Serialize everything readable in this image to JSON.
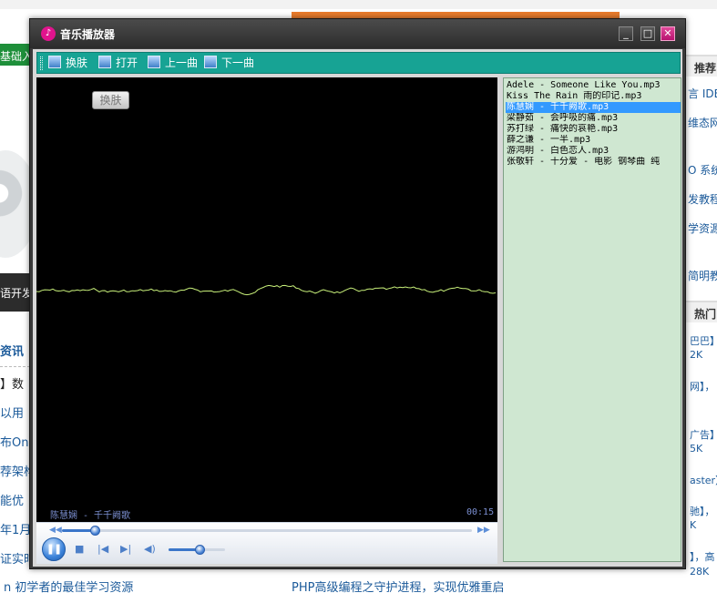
{
  "background_page": {
    "left_tab": "基础入",
    "left_banner": "语开发",
    "left_heading": "资讯",
    "left_items": [
      "】数",
      "以用",
      "布On",
      "荐架构",
      "能优",
      "年1月",
      "证实时"
    ],
    "bottom_left_link": "n 初学者的最佳学习资源",
    "bottom_mid_link": "PHP高级编程之守护进程，实现优雅重启",
    "right_heads": [
      "推荐",
      "热门"
    ],
    "right_links": [
      "言 IDE",
      "维态网",
      "O 系统",
      "发教程",
      "学资源",
      "简明教"
    ],
    "right_small": [
      "巴巴】",
      "2K",
      "网】，",
      "广告】",
      "5K",
      "aster】",
      "驰】，",
      "K",
      "】，高",
      "28K"
    ]
  },
  "window": {
    "title": "音乐播放器",
    "app_icon": "music-note-icon",
    "minimize_glyph": "_",
    "maximize_glyph": "□",
    "close_glyph": "✕"
  },
  "toolbar": {
    "items": [
      {
        "label": "换肤",
        "icon": "image-icon"
      },
      {
        "label": "打开",
        "icon": "image-icon"
      },
      {
        "label": "上一曲",
        "icon": "image-icon"
      },
      {
        "label": "下一曲",
        "icon": "image-icon"
      }
    ]
  },
  "visualizer": {
    "skin_button": "换肤",
    "now_playing": "陈慧娴 - 千千阙歌",
    "time": "00:15"
  },
  "controls": {
    "play_pause_glyph": "❚❚",
    "stop_glyph": "■",
    "prev_glyph": "|◀",
    "next_glyph": "▶|",
    "volume_glyph": "◀)",
    "seek_left": "◀◀",
    "seek_right": "▶▶",
    "progress": 0.08,
    "volume": 0.55
  },
  "playlist": {
    "items": [
      "Adele - Someone Like You.mp3",
      "Kiss The Rain 雨的印记.mp3",
      "陈慧娴 - 千千阙歌.mp3",
      "梁静茹 - 会呼吸的痛.mp3",
      "苏打绿 - 痛快的哀艳.mp3",
      "薛之谦 - 一半.mp3",
      "游鸿明 - 白色恋人.mp3",
      "张敬轩 - 十分爱 - 电影 钢琴曲 纯"
    ],
    "selected_index": 2
  },
  "colors": {
    "toolbar_bg": "#17a394",
    "playlist_bg": "#cfe7d1",
    "selection": "#3399ff",
    "wave": "#c8f07a",
    "window_frame": "#3a3a3a"
  }
}
